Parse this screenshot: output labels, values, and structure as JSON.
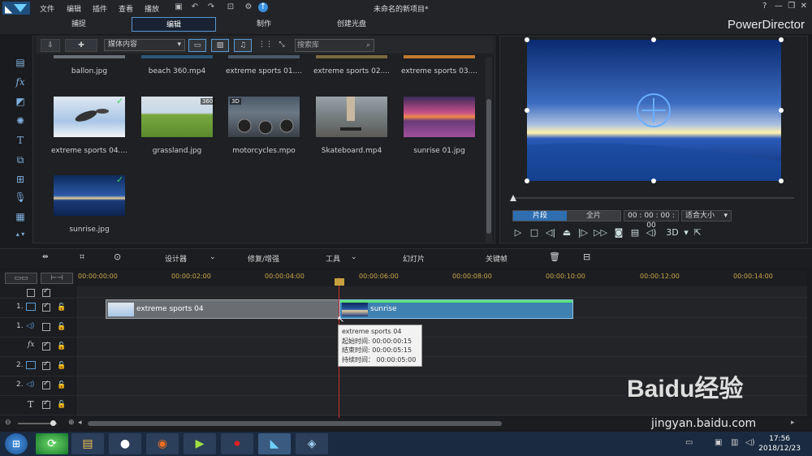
{
  "menu": {
    "file": "文件",
    "edit": "编辑",
    "plugins": "插件",
    "view": "查看",
    "play": "播放"
  },
  "window": {
    "title": "未命名的新项目*",
    "brand": "PowerDirector",
    "help": "?"
  },
  "tabs": [
    "捕捉",
    "编辑",
    "制作",
    "创建光盘"
  ],
  "active_tab": "编辑",
  "library": {
    "filter": "媒体内容",
    "search_placeholder": "搜索库",
    "row1_captions": [
      "ballon.jpg",
      "beach 360.mp4",
      "extreme sports 01....",
      "extreme sports 02....",
      "extreme sports 03...."
    ],
    "items": [
      {
        "caption": "extreme sports 04....",
        "checked": true
      },
      {
        "caption": "grassland.jpg",
        "badge": "360"
      },
      {
        "caption": "motorcycles.mpo",
        "badge": "3D"
      },
      {
        "caption": "Skateboard.mp4"
      },
      {
        "caption": "sunrise 01.jpg"
      },
      {
        "caption": "sunrise.jpg",
        "checked": true
      }
    ]
  },
  "preview": {
    "mode_clip": "片段",
    "mode_full": "全片",
    "timecode": "00 : 00 : 00 : 00",
    "fit": "适合大小",
    "threeD": "3D"
  },
  "timeline_toolbar": {
    "designer": "设计器",
    "fix": "修复/增强",
    "tools": "工具",
    "slideshow": "幻灯片",
    "keyframe": "关键帧"
  },
  "ruler": [
    "00:00:00:00",
    "00:00:02:00",
    "00:00:04:00",
    "00:00:06:00",
    "00:00:08:00",
    "00:00:10:00",
    "00:00:12:00",
    "00:00:14:00"
  ],
  "tracks": [
    {
      "label": ""
    },
    {
      "label": "1."
    },
    {
      "label": "1."
    },
    {
      "label": ""
    },
    {
      "label": "2."
    },
    {
      "label": "2."
    },
    {
      "label": ""
    }
  ],
  "clips": [
    {
      "label": "extreme sports 04"
    },
    {
      "label": "sunrise"
    }
  ],
  "tooltip": {
    "name": "extreme sports 04",
    "start": "起始时间: 00:00:00:15",
    "end": "结束时间: 00:00:05:15",
    "duration": "持续时间： 00:00:05:00"
  },
  "taskbar": {
    "time": "17:56",
    "date": "2018/12/23"
  },
  "watermark": {
    "text": "Baidu经验",
    "url": "jingyan.baidu.com"
  }
}
